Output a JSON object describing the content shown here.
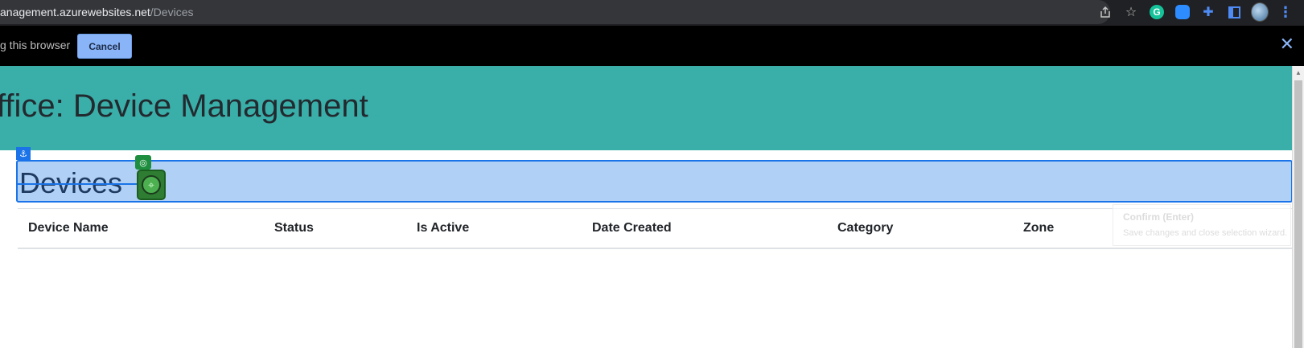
{
  "browser": {
    "url_host": "anagement.azurewebsites.net",
    "url_path": "/Devices",
    "icons": [
      "share-icon",
      "star-icon",
      "grammarly-icon",
      "zoom-extension-icon",
      "extensions-puzzle-icon",
      "side-panel-icon",
      "profile-avatar",
      "more-menu-icon"
    ],
    "grammarly_letter": "G"
  },
  "notification": {
    "text": "g this browser",
    "cancel_label": "Cancel",
    "close_glyph": "✕"
  },
  "app": {
    "title": "ffice: Device Management",
    "header_color": "#3aafa9"
  },
  "selection": {
    "heading": "Devices",
    "anchor_glyph": "⚓",
    "target_glyph": "◎",
    "handle_glyph": "⌖",
    "accent_color": "#1a73e8",
    "handle_color": "#2e7d32"
  },
  "table": {
    "columns": [
      "Device Name",
      "Status",
      "Is Active",
      "Date Created",
      "Category",
      "Zone"
    ]
  },
  "tooltip": {
    "title": "Confirm (Enter)",
    "description": "Save changes and close selection wizard."
  }
}
